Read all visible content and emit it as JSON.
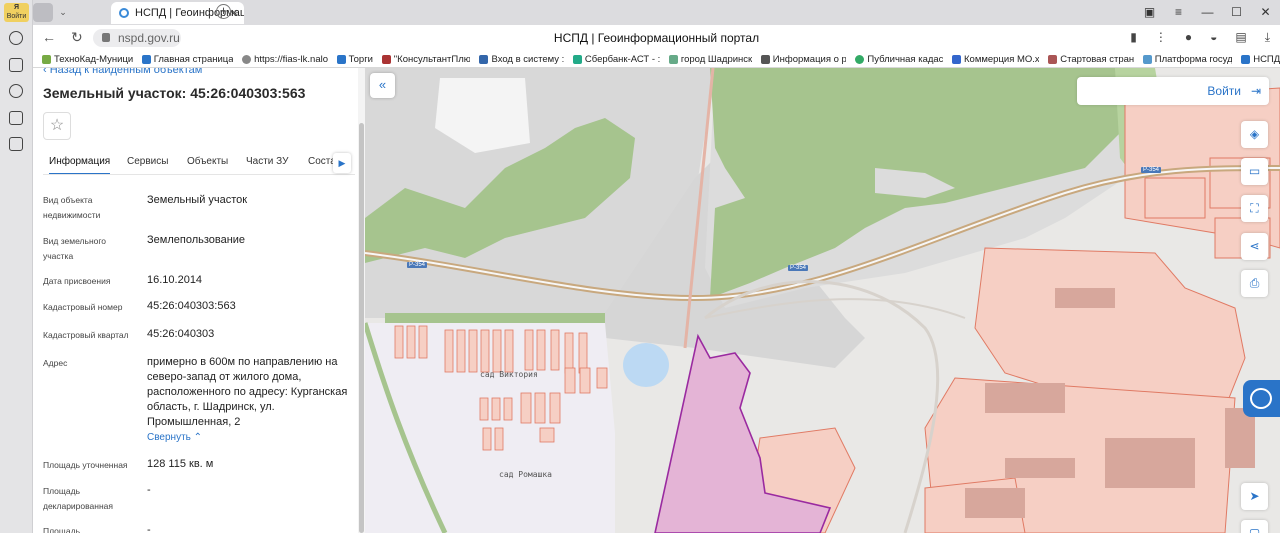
{
  "browser": {
    "logo_label": "Войти",
    "tab_title": "НСПД | Геоинформационный",
    "url": "nspd.gov.ru",
    "page_title": "НСПД | Геоинформационный портал",
    "bookmarks": [
      "ТехноКад-Муници",
      "Главная страница",
      "https://fias-lk.nalo",
      "Торги",
      "\"КонсультантПлю",
      "Вход в систему :",
      "Сбербанк-АСТ - :",
      "город Шадринск",
      "Информация о р",
      "Публичная кадас",
      "Коммерция МО.х",
      "Стартовая стран",
      "Платформа госуд",
      "НСПД"
    ]
  },
  "panel": {
    "back_label": "Назад к найденным объектам",
    "title": "Земельный участок: 45:26:040303:563",
    "tabs": [
      "Информация",
      "Сервисы",
      "Объекты",
      "Части ЗУ",
      "Соста"
    ],
    "fields": [
      {
        "key": "Вид объекта недвижимости",
        "value": "Земельный участок"
      },
      {
        "key": "Вид земельного участка",
        "value": "Землепользование"
      },
      {
        "key": "Дата присвоения",
        "value": "16.10.2014"
      },
      {
        "key": "Кадастровый номер",
        "value": "45:26:040303:563"
      },
      {
        "key": "Кадастровый квартал",
        "value": "45:26:040303"
      },
      {
        "key": "Адрес",
        "value": "примерно в 600м по направлению на северо-запад от жилого дома, расположенного по адресу: Курганская область, г. Шадринск, ул. Промышленная, 2"
      },
      {
        "key": "Площадь уточненная",
        "value": "128 115 кв. м"
      },
      {
        "key": "Площадь декларированная",
        "value": "-"
      },
      {
        "key": "Площадь",
        "value": "-"
      }
    ],
    "collapse_label": "Свернуть"
  },
  "map": {
    "login_label": "Войти",
    "labels": [
      "сад Виктория",
      "сад Ромашка"
    ],
    "road_tags": [
      "Р-354",
      "Р-354",
      "Р-354"
    ],
    "colors": {
      "forest": "#a6c48e",
      "parcel": "#f6cfc4",
      "parcel_line": "#e07a64",
      "selected": "#e4b4d6",
      "selected_line": "#9a2aa0",
      "road": "#c8a87e",
      "water": "#bcd9f3",
      "accent": "#2a74c8"
    }
  }
}
